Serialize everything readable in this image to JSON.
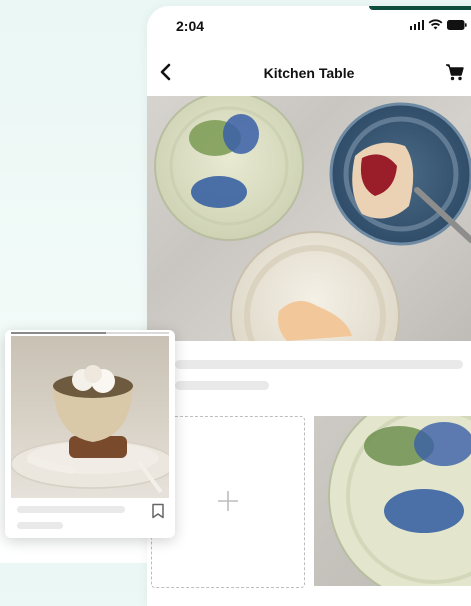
{
  "status_bar": {
    "time": "2:04"
  },
  "header": {
    "title": "Kitchen Table"
  },
  "card": {
    "image_progress": 0.6
  },
  "icons": {
    "back": "chevron-left-icon",
    "cart": "cart-icon",
    "add": "plus-icon",
    "save": "bookmark-icon",
    "signal": "signal-icon",
    "wifi": "wifi-icon",
    "battery": "battery-icon"
  },
  "colors": {
    "accent": "#0f4d3d",
    "skeleton": "#e9e9ea",
    "text": "#111111"
  }
}
